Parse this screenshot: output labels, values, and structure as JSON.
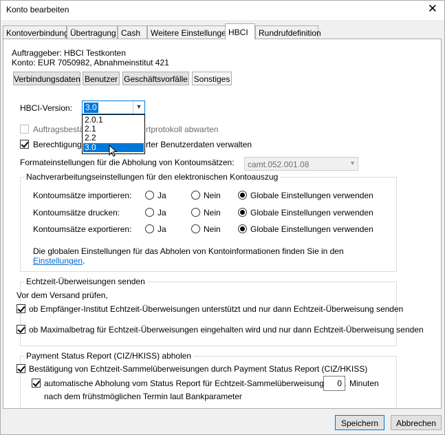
{
  "window": {
    "title": "Konto bearbeiten",
    "close_glyph": "✕"
  },
  "tabs": [
    "Kontoverbindung",
    "Übertragung",
    "Cash",
    "Weitere Einstellungen",
    "HBCI",
    "Rundrufdefinition"
  ],
  "info": {
    "auftraggeber": "Auftraggeber: HBCI Testkonten",
    "konto": "Konto: EUR 7050982, Abnahmeinstitut 421"
  },
  "subtabs": [
    "Verbindungsdaten",
    "Benutzer",
    "Geschäftsvorfälle",
    "Sonstiges"
  ],
  "hbci_version": {
    "label": "HBCI-Version:",
    "value": "3.0",
    "options": [
      "2.0.1",
      "2.1",
      "2.2",
      "3.0"
    ]
  },
  "checkbox_auftrag": {
    "left_part": "Auftragsbestä",
    "right_part": "rtprotokoll abwarten"
  },
  "checkbox_berechtigung": {
    "left_part": "Berechtigungen",
    "right_part": "rter Benutzerdaten verwalten"
  },
  "format": {
    "label": "Formateinstellungen für die Abholung von Kontoumsätzen:",
    "value": "camt.052.001.08"
  },
  "nachverarbeitung": {
    "title": "Nachverarbeitungseinstellungen für den elektronischen Kontoauszug",
    "rows": [
      {
        "label": "Kontoumsätze importieren:"
      },
      {
        "label": "Kontoumsätze drucken:"
      },
      {
        "label": "Kontoumsätze exportieren:"
      }
    ],
    "options": {
      "ja": "Ja",
      "nein": "Nein",
      "global": "Globale Einstellungen verwenden"
    },
    "note": "Die globalen Einstellungen für das Abholen von Kontoinformationen finden Sie in den",
    "link": "Einstellungen",
    "link_suffix": "."
  },
  "echtzeit": {
    "title": "Echtzeit-Überweisungen senden",
    "intro": "Vor dem Versand prüfen,",
    "check1": "ob Empfänger-Institut Echtzeit-Überweisungen unterstützt und nur dann Echtzeit-Überweisung senden",
    "check2": "ob Maximalbetrag für Echtzeit-Überweisungen eingehalten wird und nur dann Echtzeit-Überweisung senden"
  },
  "payment_status": {
    "title": "Payment Status Report (CIZ/HKISS) abholen",
    "check1": "Bestätigung von Echtzeit-Sammelüberweisungen durch Payment Status Report (CIZ/HKISS)",
    "check2": "automatische Abholung vom Status Report für Echtzeit-Sammelüberweisungen ca.",
    "minutes_value": "0",
    "minutes_label": "Minuten",
    "line3": "nach dem frühstmöglichen Termin laut Bankparameter"
  },
  "footer": {
    "save": "Speichern",
    "cancel": "Abbrechen"
  }
}
